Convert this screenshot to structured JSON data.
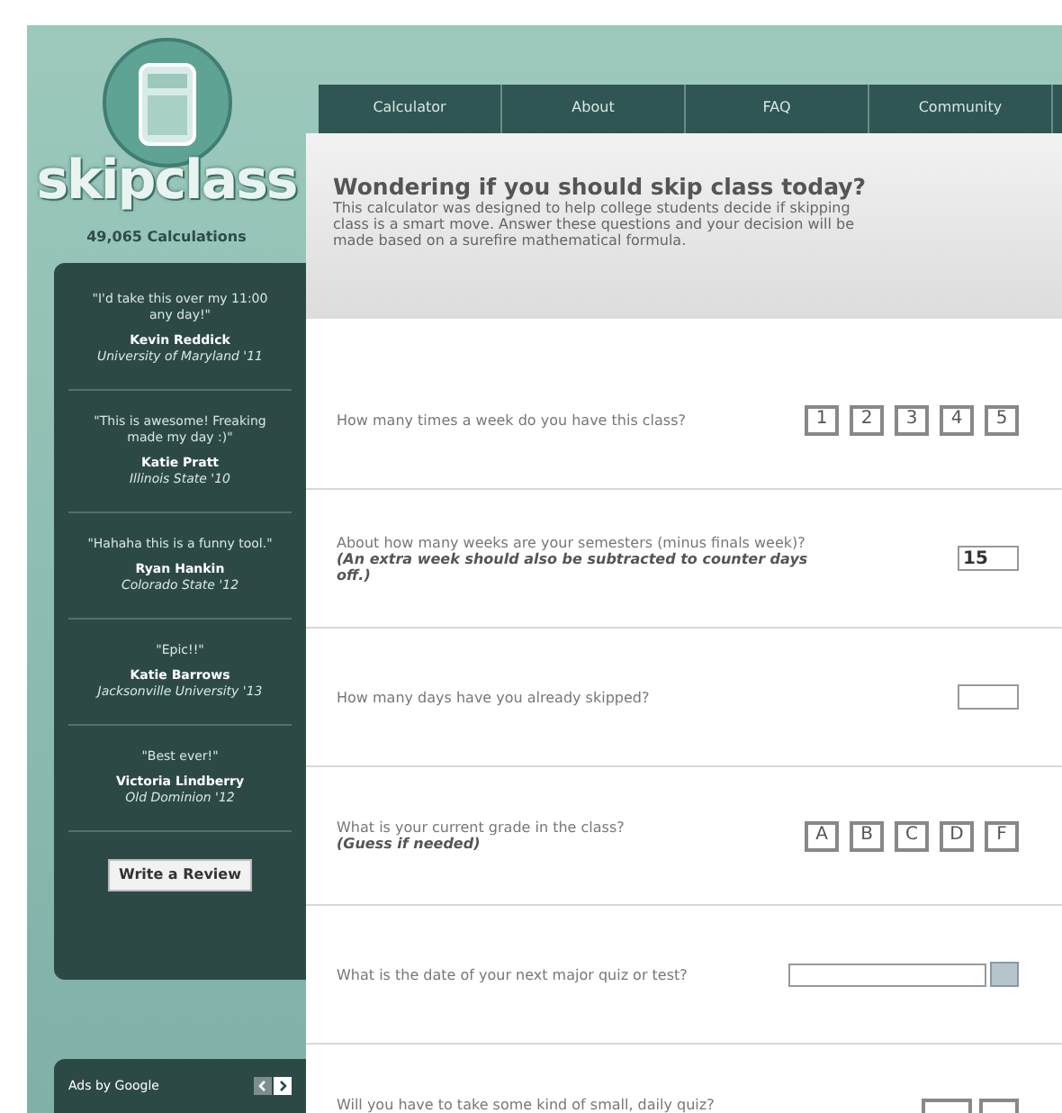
{
  "logo": {
    "text": "skipclass"
  },
  "counter": "49,065 Calculations",
  "reviews": [
    {
      "quote": "\"I'd take this over my 11:00 any day!\"",
      "name": "Kevin Reddick",
      "school": "University of Maryland '11"
    },
    {
      "quote": "\"This is awesome! Freaking made my day :)\"",
      "name": "Katie Pratt",
      "school": "Illinois State '10"
    },
    {
      "quote": "\"Hahaha this is a funny tool.\"",
      "name": "Ryan Hankin",
      "school": "Colorado State '12"
    },
    {
      "quote": "\"Epic!!\"",
      "name": "Katie Barrows",
      "school": "Jacksonville University '13"
    },
    {
      "quote": "\"Best ever!\"",
      "name": "Victoria Lindberry",
      "school": "Old Dominion '12"
    }
  ],
  "review_button": "Write a Review",
  "ads": {
    "label": "Ads by Google"
  },
  "nav": [
    {
      "label": "Calculator",
      "selected": false
    },
    {
      "label": "About",
      "selected": false
    },
    {
      "label": "FAQ",
      "selected": false
    },
    {
      "label": "Community",
      "selected": false
    }
  ],
  "header": {
    "title": "Wondering if you should skip class today?",
    "text": "This calculator was designed to help college students decide if skipping class is a smart move. Answer these questions and your decision will be made based on a surefire mathematical formula."
  },
  "questions": [
    {
      "kind": "choice",
      "text": "How many times a week do you have this class?",
      "options": [
        {
          "label": "1",
          "selected": false
        },
        {
          "label": "2",
          "selected": false
        },
        {
          "label": "3",
          "selected": false
        },
        {
          "label": "4",
          "selected": false
        },
        {
          "label": "5",
          "selected": false
        }
      ]
    },
    {
      "kind": "number",
      "text": "About how many weeks are your semesters (minus finals week)?",
      "note": "(An extra week should also be subtracted to counter days off.)",
      "value": "15"
    },
    {
      "kind": "number",
      "text": "How many days have you already skipped?"
    },
    {
      "kind": "choice",
      "text": "What is your current grade in the class?",
      "note": "(Guess if needed)",
      "options": [
        {
          "label": "A",
          "selected": false
        },
        {
          "label": "B",
          "selected": false
        },
        {
          "label": "C",
          "selected": false
        },
        {
          "label": "D",
          "selected": false
        },
        {
          "label": "F",
          "selected": false
        }
      ]
    },
    {
      "kind": "date",
      "text": "What is the date of your next major quiz or test?"
    },
    {
      "kind": "pair",
      "text": "Will you have to take some kind of small, daily quiz?"
    }
  ]
}
